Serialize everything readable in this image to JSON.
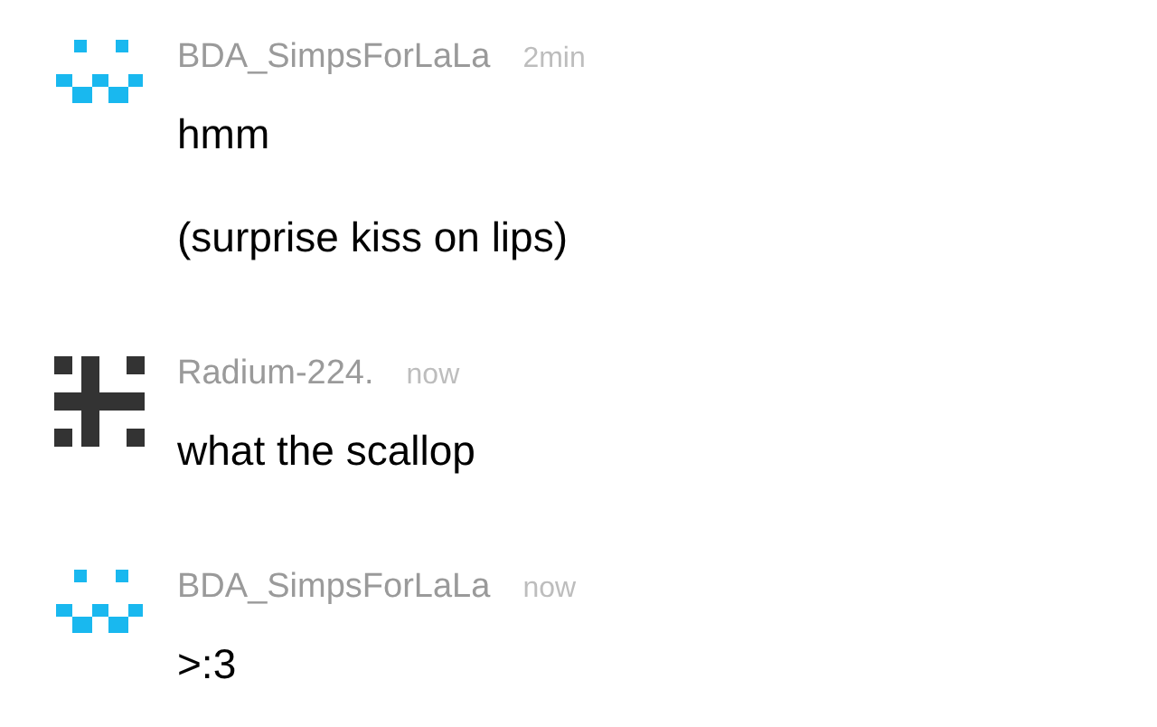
{
  "messages": [
    {
      "author": "BDA_SimpsForLaLa",
      "time": "2min",
      "avatar": {
        "kind": "dots"
      },
      "lines": [
        "hmm",
        "(surprise kiss on lips)"
      ]
    },
    {
      "author": "Radium-224.",
      "time": "now",
      "avatar": {
        "kind": "cross"
      },
      "lines": [
        "what the scallop"
      ]
    },
    {
      "author": "BDA_SimpsForLaLa",
      "time": "now",
      "avatar": {
        "kind": "dots"
      },
      "lines": [
        ">:3"
      ]
    }
  ]
}
